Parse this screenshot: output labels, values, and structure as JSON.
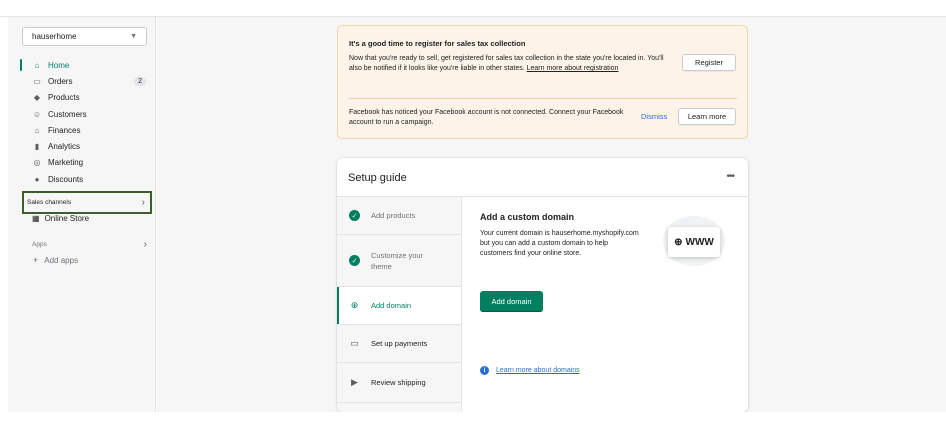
{
  "sidebar": {
    "store_name": "hauserhome",
    "nav": [
      {
        "label": "Home",
        "icon": "home-icon",
        "glyph": "⌂"
      },
      {
        "label": "Orders",
        "icon": "orders-icon",
        "glyph": "▭",
        "count": "2"
      },
      {
        "label": "Products",
        "icon": "tag-icon",
        "glyph": "◆"
      },
      {
        "label": "Customers",
        "icon": "person-icon",
        "glyph": "☺"
      },
      {
        "label": "Finances",
        "icon": "bank-icon",
        "glyph": "⌂"
      },
      {
        "label": "Analytics",
        "icon": "bar-chart-icon",
        "glyph": "▮"
      },
      {
        "label": "Marketing",
        "icon": "target-icon",
        "glyph": "◎"
      },
      {
        "label": "Discounts",
        "icon": "discount-icon",
        "glyph": "●"
      }
    ],
    "sales_channels_label": "Sales channels",
    "online_store_label": "Online Store",
    "apps_label": "Apps",
    "add_apps_label": "Add apps"
  },
  "banner": {
    "title": "It's a good time to register for sales tax collection",
    "text": "Now that you're ready to sell, get registered for sales tax collection in the state you're located in. You'll also be notified if it looks like you're liable in other states.",
    "link": "Learn more about registration",
    "register_label": "Register",
    "facebook_text": "Facebook has noticed your Facebook account is not connected. Connect your Facebook account to run a campaign.",
    "dismiss_label": "Dismiss",
    "learn_more_label": "Learn more"
  },
  "setup": {
    "title": "Setup guide",
    "more_label": "•••",
    "steps": [
      {
        "label": "Add products"
      },
      {
        "label": "Customize your theme"
      },
      {
        "label": "Add domain"
      },
      {
        "label": "Set up payments"
      },
      {
        "label": "Review shipping"
      }
    ],
    "detail_title": "Add a custom domain",
    "detail_text": "Your current domain is hauserhome.myshopify.com but you can add a custom domain to help customers find your online store.",
    "primary_button": "Add domain",
    "www_label": "WWW",
    "learn_domains": "Learn more about domains"
  },
  "colors": {
    "accent": "#008060",
    "banner_bg": "#fdf3e8",
    "link": "#2c6ecb",
    "highlight_border": "#3f5e2c"
  }
}
